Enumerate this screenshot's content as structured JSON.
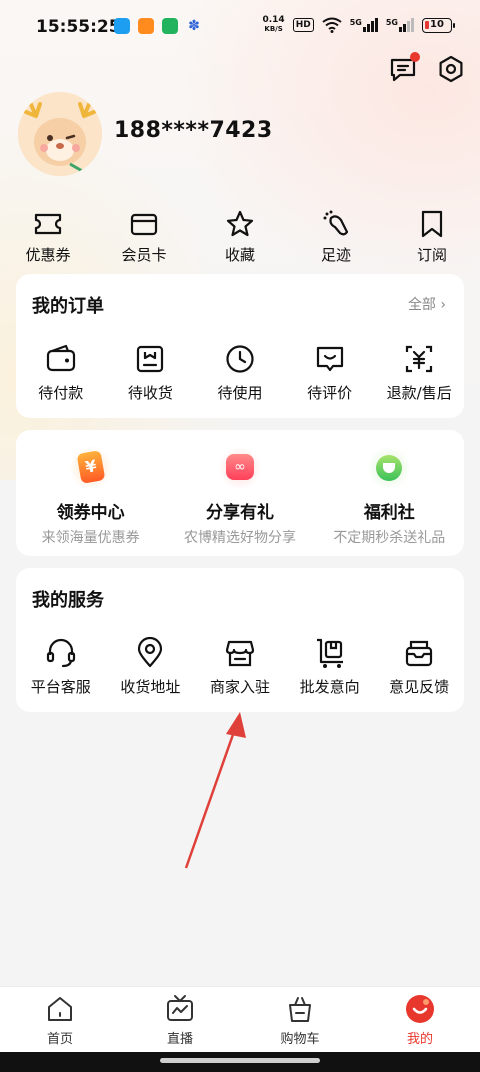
{
  "status_bar": {
    "time": "15:55:25",
    "net_speed": "0.14",
    "net_unit": "KB/S",
    "hd": "HD",
    "sig1": "5G",
    "sig2": "5G",
    "battery": "10"
  },
  "profile": {
    "phone": "188****7423"
  },
  "quick_links": [
    "优惠券",
    "会员卡",
    "收藏",
    "足迹",
    "订阅"
  ],
  "orders": {
    "title": "我的订单",
    "more": "全部",
    "items": [
      "待付款",
      "待收货",
      "待使用",
      "待评价",
      "退款/售后"
    ]
  },
  "promos": [
    {
      "title": "领券中心",
      "subtitle": "来领海量优惠券"
    },
    {
      "title": "分享有礼",
      "subtitle": "农博精选好物分享"
    },
    {
      "title": "福利社",
      "subtitle": "不定期秒杀送礼品"
    }
  ],
  "services": {
    "title": "我的服务",
    "items": [
      "平台客服",
      "收货地址",
      "商家入驻",
      "批发意向",
      "意见反馈"
    ]
  },
  "bottom_nav": [
    "首页",
    "直播",
    "购物车",
    "我的"
  ],
  "colors": {
    "accent": "#e8372c",
    "annotation": "#e0403a"
  }
}
